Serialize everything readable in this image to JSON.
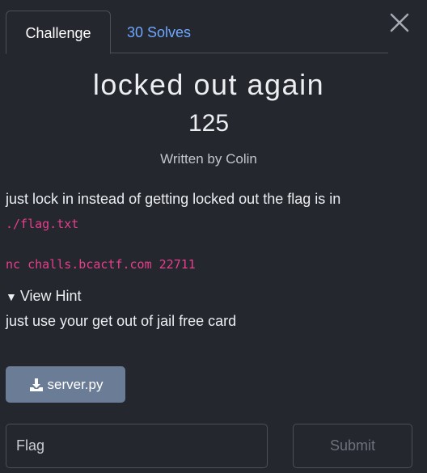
{
  "tabs": {
    "challenge": "Challenge",
    "solves": "30 Solves"
  },
  "challenge": {
    "name": "locked out again",
    "points": "125",
    "author_prefix": "Written by",
    "author": "Colin",
    "description": "just lock in instead of getting locked out the flag is in",
    "flag_path": "./flag.txt",
    "connection": "nc challs.bcactf.com 22711"
  },
  "hint": {
    "toggle_label": "View Hint",
    "text": "just use your get out of jail free card"
  },
  "files": [
    {
      "label": "server.py",
      "icon": "download-icon"
    }
  ],
  "flag_form": {
    "placeholder": "Flag",
    "value": "",
    "submit_label": "Submit"
  },
  "colors": {
    "background": "#24272e",
    "link": "#6ea7ff",
    "code": "#e83e8c",
    "file_button": "#6b7c96",
    "border": "#4a4f59"
  }
}
